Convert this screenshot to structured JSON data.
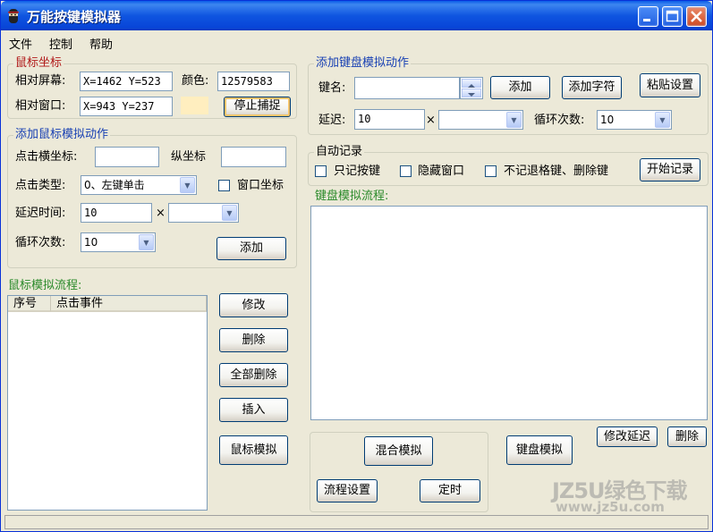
{
  "window": {
    "title": "万能按键模拟器"
  },
  "menu": [
    "文件",
    "控制",
    "帮助"
  ],
  "mouse_coords": {
    "group_title": "鼠标坐标",
    "screen_label": "相对屏幕:",
    "screen_value": "X=1462 Y=523",
    "color_label": "颜色:",
    "color_value": "12579583",
    "color_swatch": "#ffeebf",
    "window_label": "相对窗口:",
    "window_value": "X=943 Y=237",
    "stop_capture": "停止捕捉"
  },
  "mouse_action": {
    "group_title": "添加鼠标模拟动作",
    "click_x_label": "点击横坐标:",
    "click_y_label": "纵坐标",
    "click_type_label": "点击类型:",
    "click_type_value": "0、左键单击",
    "window_coord_label": "窗口坐标",
    "delay_label": "延迟时间:",
    "delay_value": "10",
    "times_symbol": "×",
    "loop_label": "循环次数:",
    "loop_value": "10",
    "add_button": "添加"
  },
  "mouse_flow": {
    "title": "鼠标模拟流程:",
    "col_seq": "序号",
    "col_event": "点击事件",
    "modify": "修改",
    "delete": "删除",
    "delete_all": "全部删除",
    "insert": "插入",
    "simulate": "鼠标模拟"
  },
  "keyboard_action": {
    "group_title": "添加键盘模拟动作",
    "key_label": "键名:",
    "add_button": "添加",
    "add_chars": "添加字符",
    "paste_settings": "粘贴设置",
    "delay_label": "延迟:",
    "delay_value": "10",
    "times_symbol": "×",
    "loop_label": "循环次数:",
    "loop_value": "10"
  },
  "auto_record": {
    "group_title": "自动记录",
    "only_keys": "只记按键",
    "hide_window": "隐藏窗口",
    "no_backspace": "不记退格键、删除键",
    "start_record": "开始记录"
  },
  "keyboard_flow": {
    "title": "键盘模拟流程:",
    "modify_delay": "修改延迟",
    "delete": "删除",
    "simulate": "键盘模拟"
  },
  "bottom": {
    "mixed_sim": "混合模拟",
    "flow_settings": "流程设置",
    "timer": "定时"
  },
  "watermark": {
    "line1": "JZ5U绿色下载",
    "line2": "www.jz5u.com"
  }
}
